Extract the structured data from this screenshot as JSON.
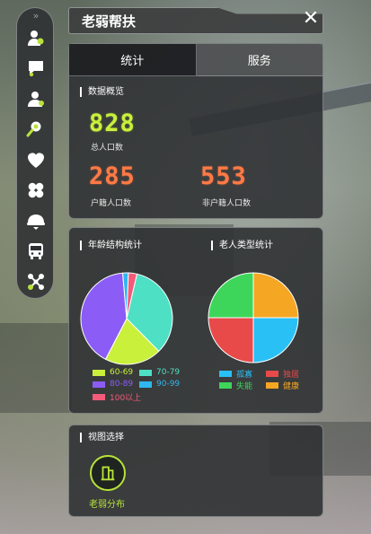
{
  "toolbar": {
    "collapse_glyph": "»",
    "items": [
      {
        "icon": "elderly-user-icon",
        "active": true
      },
      {
        "icon": "chat-bubble-icon"
      },
      {
        "icon": "users-icon"
      },
      {
        "icon": "search-person-icon"
      },
      {
        "icon": "heart-icon"
      },
      {
        "icon": "clover-icon"
      },
      {
        "icon": "cap-icon"
      },
      {
        "icon": "bus-icon"
      },
      {
        "icon": "network-icon"
      }
    ]
  },
  "panel": {
    "title": "老弱帮扶",
    "close_glyph": "✕",
    "tabs": [
      {
        "label": "统计",
        "active": true
      },
      {
        "label": "服务",
        "active": false
      }
    ]
  },
  "overview": {
    "section_title": "数据概览",
    "total": {
      "value": "828",
      "label": "总人口数"
    },
    "registered": {
      "value": "285",
      "label": "户籍人口数"
    },
    "non_registered": {
      "value": "553",
      "label": "非户籍人口数"
    }
  },
  "charts": {
    "age_title": "年龄结构统计",
    "type_title": "老人类型统计"
  },
  "chart_data": [
    {
      "type": "pie",
      "title": "年龄结构统计",
      "categories": [
        "70-79",
        "60-69",
        "80-89",
        "90-99",
        "100以上"
      ],
      "values": [
        34,
        20,
        41,
        2,
        3
      ],
      "colors": [
        "#4de0c4",
        "#c9f03a",
        "#8b5cf6",
        "#2fb7f0",
        "#f45b7a"
      ],
      "legend_order": [
        "60-69",
        "70-79",
        "80-89",
        "90-99",
        "100以上"
      ],
      "legend_colors": [
        "#c9f03a",
        "#4de0c4",
        "#8b5cf6",
        "#2fb7f0",
        "#f45b7a"
      ]
    },
    {
      "type": "pie",
      "title": "老人类型统计",
      "categories": [
        "健康",
        "孤寡",
        "独居",
        "失能"
      ],
      "values": [
        25,
        25,
        25,
        25
      ],
      "colors": [
        "#f5a623",
        "#29c0f5",
        "#e84a4a",
        "#3dd65a"
      ],
      "legend_order": [
        "孤寡",
        "独居",
        "失能",
        "健康"
      ],
      "legend_colors": [
        "#29c0f5",
        "#e84a4a",
        "#3dd65a",
        "#f5a623"
      ]
    }
  ],
  "view": {
    "section_title": "视图选择",
    "option_label": "老弱分布",
    "option_icon": "building-icon"
  },
  "colors": {
    "accent_green": "#c9f03a",
    "accent_orange": "#ff7a45"
  }
}
